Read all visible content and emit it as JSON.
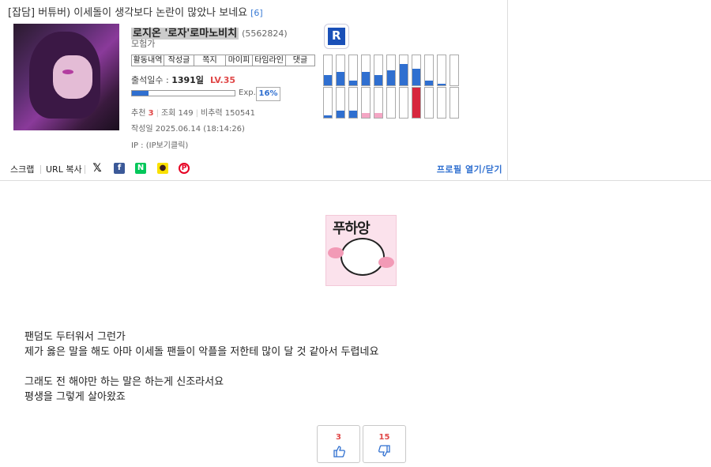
{
  "post": {
    "title": "[잡담] 버튜버) 이세돌이 생각보다 논란이 많았나 보네요",
    "comment_count": "[6]"
  },
  "author": {
    "nickname": "로지온 '로자'로마노비치",
    "uid": "(5562824)",
    "rank": "모험가",
    "menu": [
      "활동내역",
      "작성글",
      "쪽지",
      "마이피",
      "타임라인",
      "댓글"
    ],
    "attendance_label": "출석일수 :",
    "attendance_value": "1391일",
    "level": "LV.35",
    "exp_label": "Exp.",
    "exp_percent": "16%",
    "exp_fraction": 0.16
  },
  "stats": {
    "recommend_label": "추천",
    "recommend_value": "3",
    "views_label": "조회",
    "views_value": "149",
    "bitoryeok_label": "비추력",
    "bitoryeok_value": "150541",
    "date_label": "작성일",
    "date_value": "2025.06.14 (18:14:26)",
    "ip_label": "IP :",
    "ip_value": "(IP보기클릭)"
  },
  "activity_graph": {
    "top_fill": [
      0.35,
      0.45,
      0.15,
      0.45,
      0.35,
      0.5,
      0.7,
      0.55,
      0.15,
      0.05,
      0
    ],
    "top_colors": [
      "#2f6fd0",
      "#2f6fd0",
      "#2f6fd0",
      "#2f6fd0",
      "#2f6fd0",
      "#2f6fd0",
      "#2f6fd0",
      "#2f6fd0",
      "#2f6fd0",
      "#2f6fd0",
      "#2f6fd0"
    ],
    "bottom_fill": [
      0.08,
      0.25,
      0.25,
      0.15,
      0.15,
      0,
      0,
      1.0,
      0,
      0,
      0
    ],
    "bottom_colors": [
      "#2f6fd0",
      "#2f6fd0",
      "#2f6fd0",
      "#f4a6c4",
      "#f4a6c4",
      "#2f6fd0",
      "#2f6fd0",
      "#d7263d",
      "#2f6fd0",
      "#2f6fd0",
      "#2f6fd0"
    ]
  },
  "footer": {
    "scrap": "스크랩",
    "url_copy": "URL 복사",
    "sns": [
      {
        "name": "x-icon",
        "glyph": "X",
        "color": "#000000"
      },
      {
        "name": "facebook-icon",
        "glyph": "f",
        "color": "#3b5998"
      },
      {
        "name": "naver-icon",
        "glyph": "N",
        "color": "#03c75a"
      },
      {
        "name": "kakaotalk-icon",
        "glyph": "…",
        "color": "#fae100"
      },
      {
        "name": "pinterest-icon",
        "glyph": "P",
        "color": "#e60023"
      }
    ],
    "profile_toggle": "프로필 열기/닫기"
  },
  "sticker": {
    "text": "푸하앙"
  },
  "body": {
    "lines": [
      "팬덤도 두터워서 그런가",
      "제가 옳은 말을 해도 아마 이세돌 팬들이 악플을 저한테 많이 달 것 같아서 두렵네요",
      "",
      "그래도 전 해야만 하는 말은 하는게 신조라서요",
      "평생을 그렇게 살아왔죠"
    ]
  },
  "votes": {
    "up": "3",
    "down": "15"
  },
  "colors": {
    "accent": "#2f6fd0",
    "level_red": "#e04848"
  }
}
